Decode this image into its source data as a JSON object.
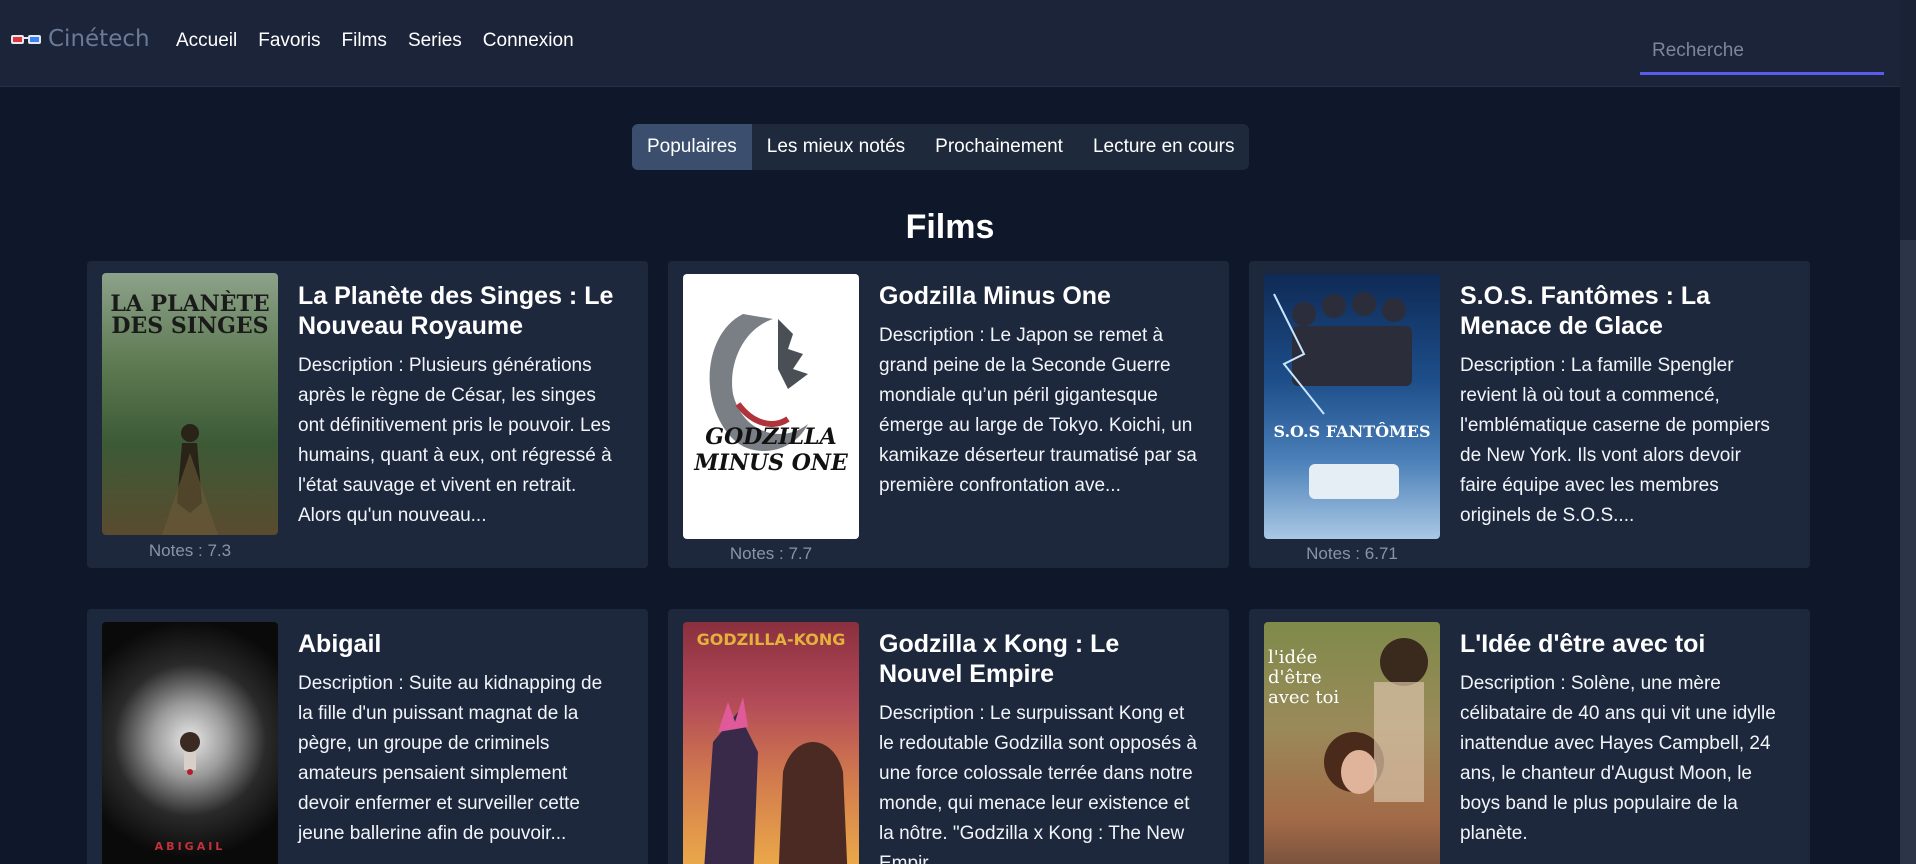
{
  "brand": {
    "name": "Cinétech",
    "icon": "3d-glasses-icon"
  },
  "nav": {
    "links": [
      "Accueil",
      "Favoris",
      "Films",
      "Series",
      "Connexion"
    ]
  },
  "search": {
    "placeholder": "Recherche",
    "value": ""
  },
  "tabs": [
    {
      "label": "Populaires",
      "active": true
    },
    {
      "label": "Les mieux notés",
      "active": false
    },
    {
      "label": "Prochainement",
      "active": false
    },
    {
      "label": "Lecture en cours",
      "active": false
    }
  ],
  "section_title": "Films",
  "movies": [
    {
      "title": "La Planète des Singes : Le Nouveau Royaume",
      "description": "Description : Plusieurs générations après le règne de César, les singes ont définitivement pris le pouvoir. Les humains, quant à eux, ont régressé à l'état sauvage et vivent en retrait. Alors qu'un nouveau...",
      "rating": "Notes : 7.3",
      "poster_text": "LA PLANÈTE DES SINGES"
    },
    {
      "title": "Godzilla Minus One",
      "description": "Description : Le Japon se remet à grand peine de la Seconde Guerre mondiale qu’un péril gigantesque émerge au large de Tokyo. Koichi, un kamikaze déserteur traumatisé par sa première confrontation ave...",
      "rating": "Notes : 7.7",
      "poster_text": "GODZILLA MINUS ONE"
    },
    {
      "title": "S.O.S. Fantômes : La Menace de Glace",
      "description": "Description : La famille Spengler revient là où tout a commencé, l'emblématique caserne de pompiers de New York. Ils vont alors devoir faire équipe avec les membres originels de S.O.S....",
      "rating": "Notes : 6.71",
      "poster_text": "S.O.S FANTÔMES"
    },
    {
      "title": "Abigail",
      "description": "Description : Suite au kidnapping de la fille d'un puissant magnat de la pègre, un groupe de criminels amateurs pensaient simplement devoir enfermer et surveiller cette jeune ballerine afin de pouvoir...",
      "rating": "",
      "poster_text": "ABIGAIL"
    },
    {
      "title": "Godzilla x Kong : Le Nouvel Empire",
      "description": "Description : Le surpuissant Kong et le redoutable Godzilla sont opposés à une force colossale terrée dans notre monde, qui menace leur existence et la nôtre. \"Godzilla x Kong : The New Empir",
      "rating": "",
      "poster_text": "GODZILLA-KONG"
    },
    {
      "title": "L'Idée d'être avec toi",
      "description": "Description : Solène, une mère célibataire de 40 ans qui vit une idylle inattendue avec Hayes Campbell, 24 ans, le chanteur d'August Moon, le boys band le plus populaire de la planète.",
      "rating": "",
      "poster_text": "l'idée d'être avec toi"
    }
  ]
}
